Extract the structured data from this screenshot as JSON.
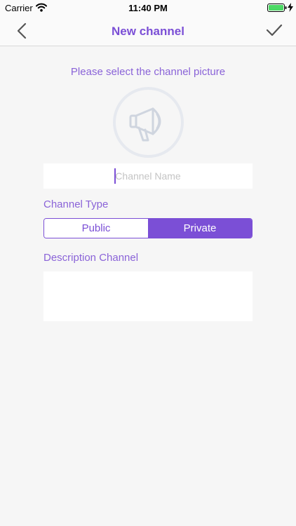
{
  "status_bar": {
    "carrier": "Carrier",
    "time": "11:40 PM",
    "icons": [
      "wifi-icon",
      "battery-icon",
      "charging-bolt-icon"
    ]
  },
  "nav": {
    "title": "New channel",
    "back_icon": "chevron-left-icon",
    "confirm_icon": "checkmark-icon"
  },
  "picture": {
    "label": "Please select the channel picture",
    "icon": "megaphone-icon"
  },
  "channel_name": {
    "value": "",
    "placeholder": "Channel Name"
  },
  "channel_type": {
    "label": "Channel Type",
    "options": [
      "Public",
      "Private"
    ],
    "selected": "Private"
  },
  "description": {
    "label": "Description Channel",
    "value": ""
  },
  "colors": {
    "accent": "#7b4fd6",
    "label": "#8a63d8",
    "background": "#f6f6f6",
    "field": "#ffffff"
  }
}
